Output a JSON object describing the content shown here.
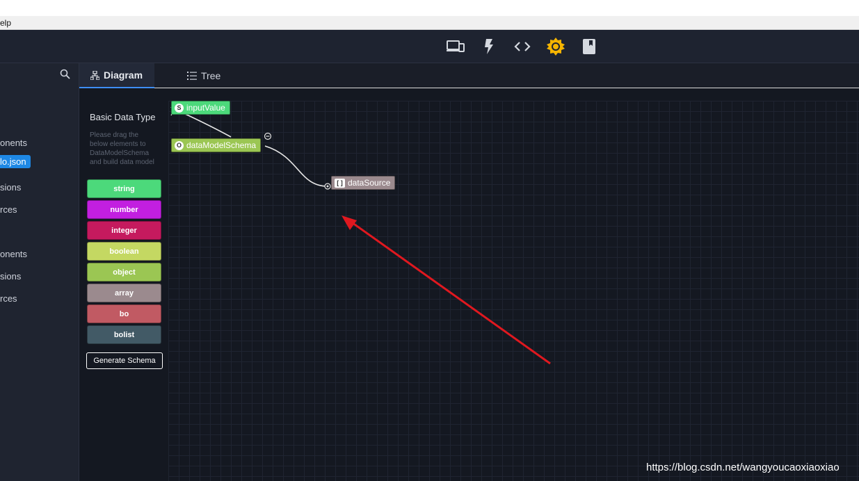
{
  "menubar": {
    "text": "elp"
  },
  "colors": {
    "accent": "#3e8ef7",
    "bulb": "#f5b400",
    "arrow": "#e0181f"
  },
  "toolbar": {
    "icons": [
      "devices-icon",
      "flash-icon",
      "code-icon",
      "theme-icon",
      "book-icon"
    ]
  },
  "sidebar": {
    "items": [
      "onents",
      "lo.json",
      "sions",
      "rces",
      "onents",
      "sions",
      "rces"
    ]
  },
  "tabs": [
    {
      "label": "Diagram"
    },
    {
      "label": "Tree"
    }
  ],
  "palette": {
    "title": "Basic Data Type",
    "hint": "Please drag the below elements to DataModelSchema and build data model",
    "types": [
      {
        "label": "string",
        "color": "#4cd97b"
      },
      {
        "label": "number",
        "color": "#c21fe0"
      },
      {
        "label": "integer",
        "color": "#c51a5e"
      },
      {
        "label": "boolean",
        "color": "#c4d862"
      },
      {
        "label": "object",
        "color": "#9bc653"
      },
      {
        "label": "array",
        "color": "#9b8a8e"
      },
      {
        "label": "bo",
        "color": "#c15a63"
      },
      {
        "label": "bolist",
        "color": "#425a66"
      }
    ],
    "generate_label": "Generate Schema"
  },
  "diagram": {
    "nodes": [
      {
        "badge": "S",
        "label": "inputValue",
        "color": "#4cd97b"
      },
      {
        "badge": "O",
        "label": "dataModelSchema",
        "color": "#9bc653"
      },
      {
        "badge": "[ ]",
        "label": "dataSource",
        "color": "#9b8a8e"
      }
    ]
  },
  "watermark": "https://blog.csdn.net/wangyoucaoxiaoxiao"
}
